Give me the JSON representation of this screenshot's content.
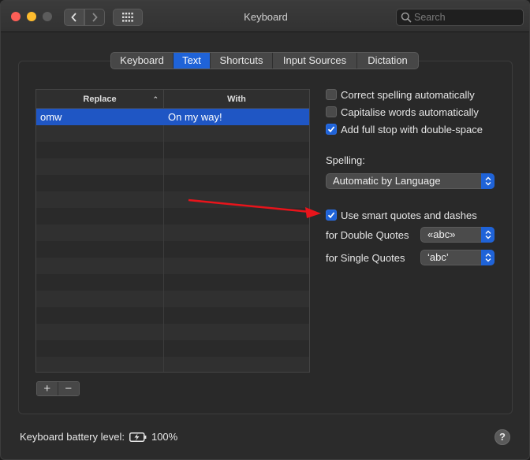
{
  "window": {
    "title": "Keyboard"
  },
  "toolbar": {
    "search_placeholder": "Search"
  },
  "tabs": [
    {
      "label": "Keyboard",
      "active": false
    },
    {
      "label": "Text",
      "active": true
    },
    {
      "label": "Shortcuts",
      "active": false
    },
    {
      "label": "Input Sources",
      "active": false
    },
    {
      "label": "Dictation",
      "active": false
    }
  ],
  "table": {
    "columns": [
      "Replace",
      "With"
    ],
    "rows": [
      {
        "replace": "omw",
        "with": "On my way!",
        "selected": true
      }
    ]
  },
  "buttons": {
    "add": "+",
    "remove": "−"
  },
  "options": {
    "correct_spelling": {
      "label": "Correct spelling automatically",
      "checked": false
    },
    "capitalise": {
      "label": "Capitalise words automatically",
      "checked": false
    },
    "full_stop": {
      "label": "Add full stop with double-space",
      "checked": true
    },
    "spelling_label": "Spelling:",
    "spelling_value": "Automatic by Language",
    "smart_quotes": {
      "label": "Use smart quotes and dashes",
      "checked": true
    },
    "double_quotes_label": "for Double Quotes",
    "double_quotes_value": "«abc»",
    "single_quotes_label": "for Single Quotes",
    "single_quotes_value": "‘abc’"
  },
  "footer": {
    "battery_label": "Keyboard battery level:",
    "battery_value": "100%",
    "help": "?"
  },
  "colors": {
    "accent": "#1f63d8",
    "annotation_arrow": "#e8141b"
  }
}
